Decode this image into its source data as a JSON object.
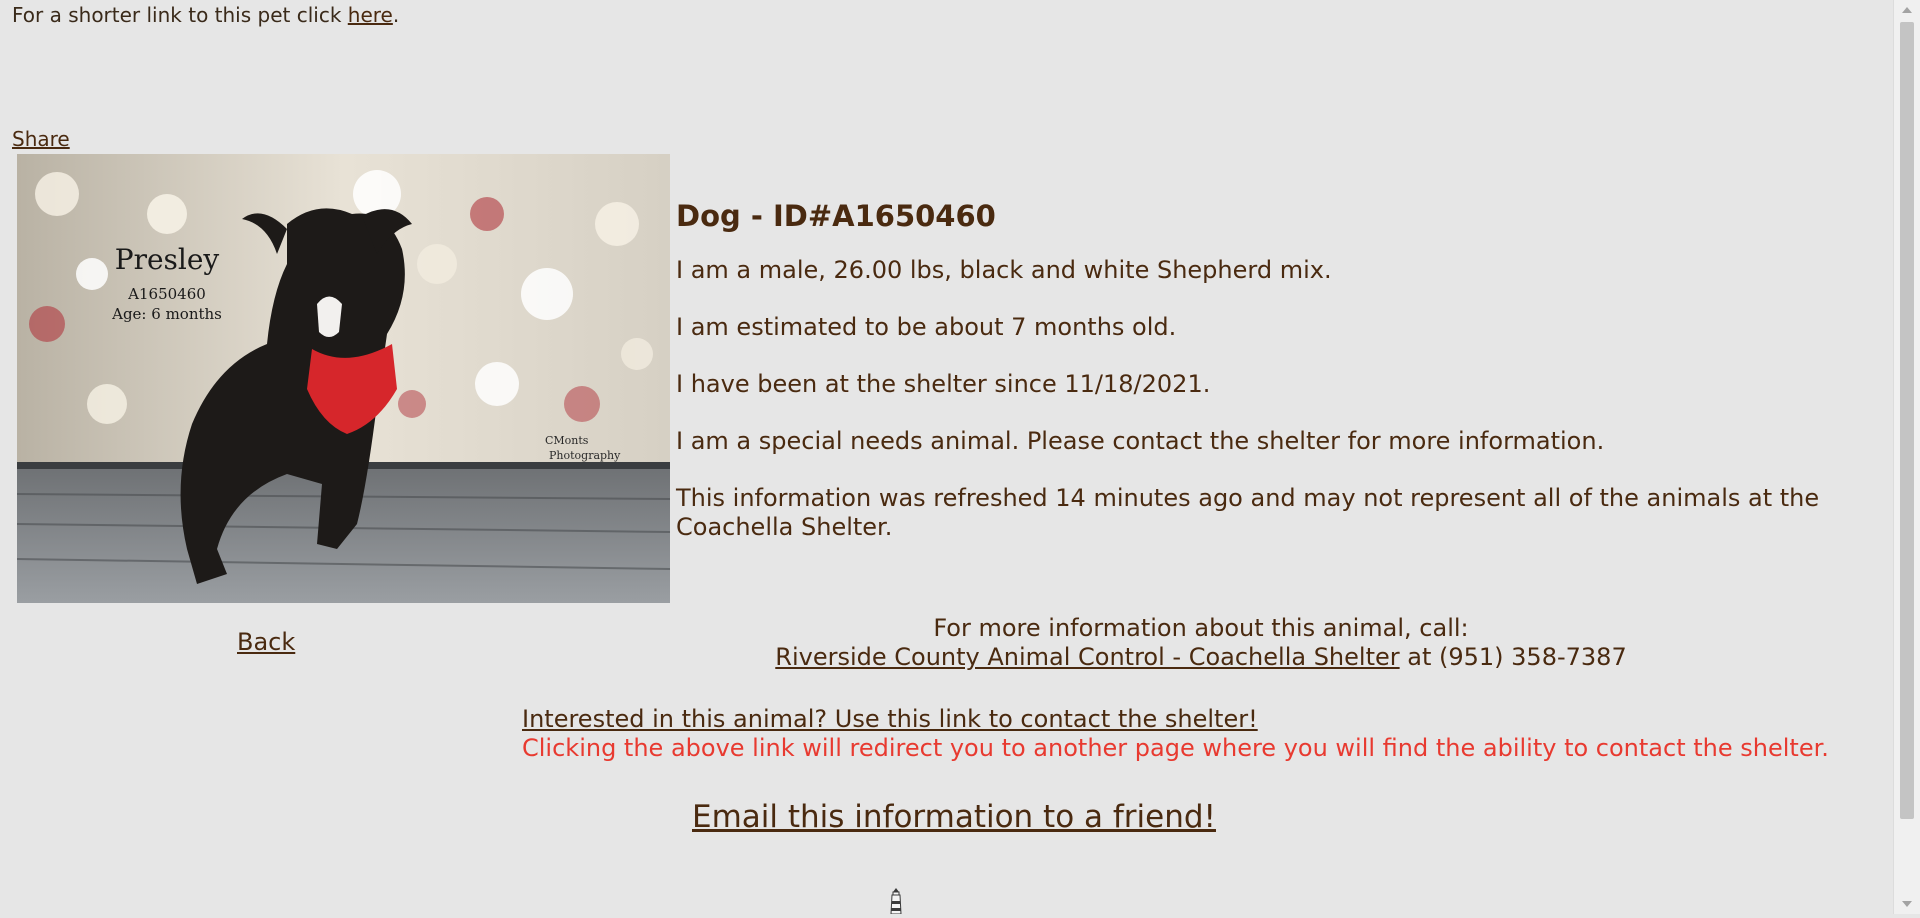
{
  "short_link": {
    "prefix": "For a shorter link to this pet click ",
    "link_label": "here",
    "suffix": "."
  },
  "share_label": "Share",
  "photo": {
    "overlay_name": "Presley",
    "overlay_id": "A1650460",
    "overlay_age": "Age: 6 months",
    "watermark_line1": "CMonts",
    "watermark_line2": "Photography"
  },
  "pet": {
    "title": "Dog - ID#A1650460",
    "description": "I am a male, 26.00 lbs, black and white Shepherd mix.",
    "age_estimate": "I am estimated to be about 7 months old.",
    "shelter_since": "I have been at the shelter since 11/18/2021.",
    "special_needs": "I am a special needs animal. Please contact the shelter for more information.",
    "refresh_note": "This information was refreshed 14 minutes ago and may not represent all of the animals at the Coachella Shelter."
  },
  "back_label": "Back",
  "contact": {
    "intro": "For more information about this animal, call:",
    "shelter_link": "Riverside County Animal Control - Coachella Shelter",
    "phone_text": " at (951) 358-7387"
  },
  "interest": {
    "link_label": "Interested in this animal? Use this link to contact the shelter!",
    "redirect_note": "Clicking the above link will redirect you to another page where you will find the ability to contact the shelter."
  },
  "email_label": "Email this information to a friend!",
  "colors": {
    "background": "#e6e6e6",
    "text": "#4a2a10",
    "warning": "#e83a30"
  }
}
